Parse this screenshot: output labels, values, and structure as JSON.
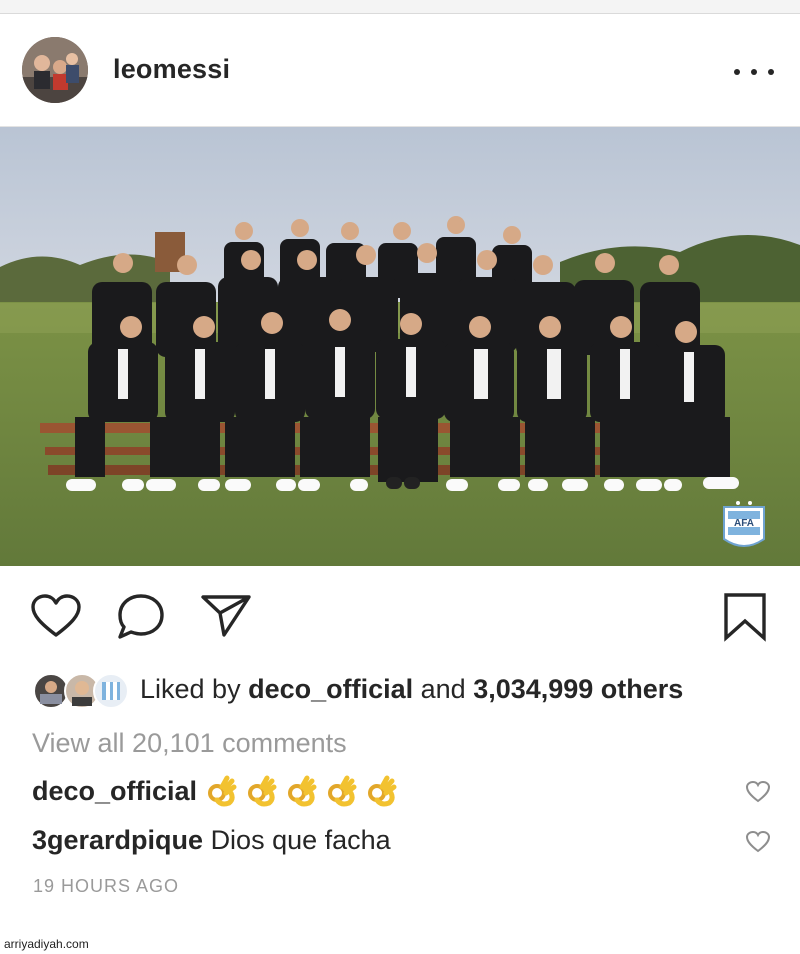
{
  "post": {
    "username": "leomessi",
    "image_watermark": "AFA"
  },
  "likes": {
    "prefix": "Liked by ",
    "liker": "deco_official",
    "joiner": " and ",
    "others": "3,034,999 others"
  },
  "comments": {
    "view_all": "View all 20,101 comments",
    "items": [
      {
        "user": "deco_official",
        "text": "",
        "emoji": "ok-hand x5"
      },
      {
        "user": "3gerardpique",
        "text": "Dios que facha"
      }
    ]
  },
  "timestamp": "19 HOURS AGO",
  "footer": {
    "watermark": "arriyadiyah.com"
  },
  "colors": {
    "text": "#262626",
    "muted": "#9a9a9a",
    "grass": "#6f8a3e",
    "suit": "#1a1a1c"
  }
}
